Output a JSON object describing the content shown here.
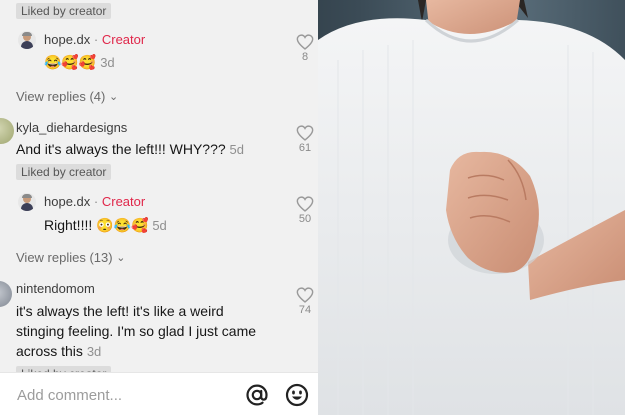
{
  "colors": {
    "creator": "#e0274a",
    "panel_bg": "#f1f1f1",
    "badge_bg": "#dcdcdc"
  },
  "comments": [
    {
      "liked_badge": "Liked by creator",
      "replies_label": "View replies (4)",
      "reply": {
        "user": "hope.dx",
        "role": "Creator",
        "sep": "·",
        "text": "😂🥰🥰",
        "time": "3d",
        "likes": "8"
      }
    },
    {
      "user": "kyla_diehardesigns",
      "text": "And it's always the left!!! WHY???",
      "time": "5d",
      "likes": "61",
      "liked_badge": "Liked by creator",
      "reply": {
        "user": "hope.dx",
        "role": "Creator",
        "sep": "·",
        "text": "Right!!!! 😳😂🥰",
        "time": "5d",
        "likes": "50"
      },
      "replies_label": "View replies (13)"
    },
    {
      "user": "nintendomom",
      "text_lines": [
        "it's always the left! it's like a weird",
        "stinging feeling. I'm so glad I just came",
        "across this"
      ],
      "time": "3d",
      "likes": "74",
      "liked_badge": "Liked by creator"
    }
  ],
  "composer": {
    "placeholder": "Add comment...",
    "mention_icon": "at-icon",
    "emoji_icon": "emoji-icon"
  },
  "photo": {
    "subject": "woman in white top with hand on chest"
  }
}
